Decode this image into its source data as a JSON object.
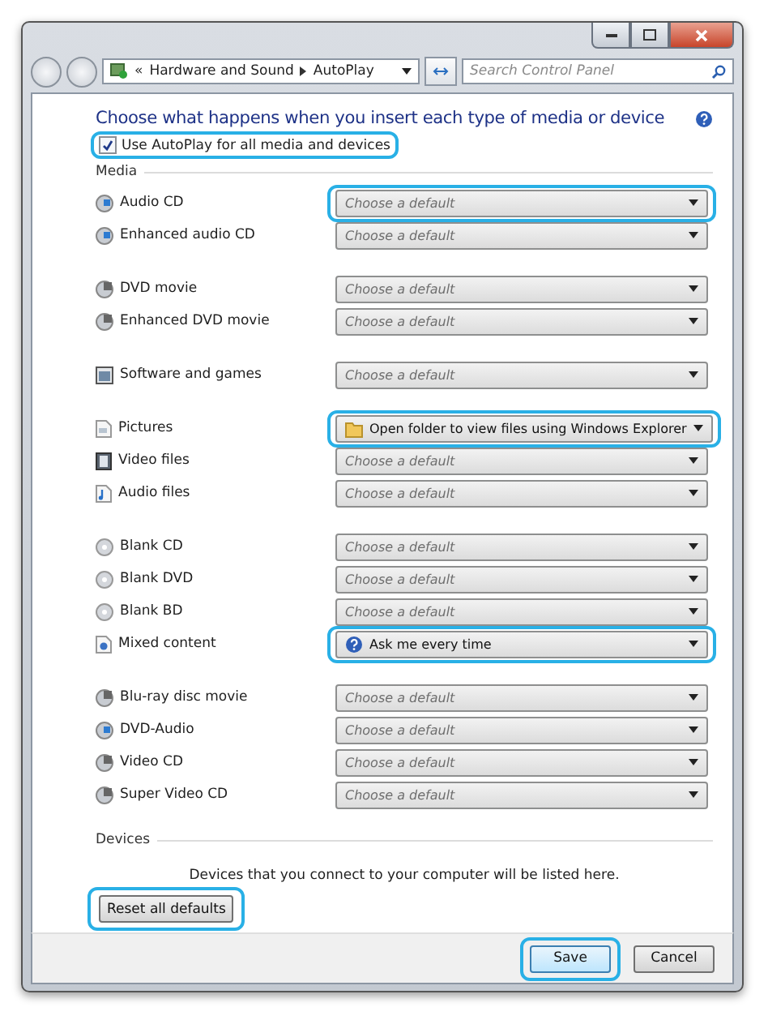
{
  "address_bar": {
    "breadcrumb": [
      "«",
      "Hardware and Sound",
      "AutoPlay"
    ]
  },
  "search": {
    "placeholder": "Search Control Panel"
  },
  "heading": "Choose what happens when you insert each type of media or device",
  "autoplay_checkbox": {
    "label": "Use AutoPlay for all media and devices",
    "checked": true,
    "highlighted": true
  },
  "media_section": {
    "title": "Media",
    "groups": [
      [
        {
          "name": "Audio CD",
          "kind": "cd",
          "choice": {
            "text": "Choose a default",
            "kind": "placeholder"
          },
          "highlighted": true
        },
        {
          "name": "Enhanced audio CD",
          "kind": "cd",
          "choice": {
            "text": "Choose a default",
            "kind": "placeholder"
          },
          "highlighted": false
        }
      ],
      [
        {
          "name": "DVD movie",
          "kind": "dvd",
          "choice": {
            "text": "Choose a default",
            "kind": "placeholder"
          },
          "highlighted": false
        },
        {
          "name": "Enhanced DVD movie",
          "kind": "dvd",
          "choice": {
            "text": "Choose a default",
            "kind": "placeholder"
          },
          "highlighted": false
        }
      ],
      [
        {
          "name": "Software and games",
          "kind": "software",
          "choice": {
            "text": "Choose a default",
            "kind": "placeholder"
          },
          "highlighted": false
        }
      ],
      [
        {
          "name": "Pictures",
          "kind": "picture",
          "choice": {
            "text": "Open folder to view files using Windows Explorer",
            "kind": "folder"
          },
          "highlighted": true
        },
        {
          "name": "Video files",
          "kind": "video",
          "choice": {
            "text": "Choose a default",
            "kind": "placeholder"
          },
          "highlighted": false
        },
        {
          "name": "Audio files",
          "kind": "audio",
          "choice": {
            "text": "Choose a default",
            "kind": "placeholder"
          },
          "highlighted": false
        }
      ],
      [
        {
          "name": "Blank CD",
          "kind": "blank",
          "choice": {
            "text": "Choose a default",
            "kind": "placeholder"
          },
          "highlighted": false
        },
        {
          "name": "Blank DVD",
          "kind": "blank",
          "choice": {
            "text": "Choose a default",
            "kind": "placeholder"
          },
          "highlighted": false
        },
        {
          "name": "Blank BD",
          "kind": "blank",
          "choice": {
            "text": "Choose a default",
            "kind": "placeholder"
          },
          "highlighted": false
        },
        {
          "name": "Mixed content",
          "kind": "mixed",
          "choice": {
            "text": "Ask me every time",
            "kind": "help"
          },
          "highlighted": true
        }
      ],
      [
        {
          "name": "Blu-ray disc movie",
          "kind": "dvd",
          "choice": {
            "text": "Choose a default",
            "kind": "placeholder"
          },
          "highlighted": false
        },
        {
          "name": "DVD-Audio",
          "kind": "cd",
          "choice": {
            "text": "Choose a default",
            "kind": "placeholder"
          },
          "highlighted": false
        },
        {
          "name": "Video CD",
          "kind": "dvd",
          "choice": {
            "text": "Choose a default",
            "kind": "placeholder"
          },
          "highlighted": false
        },
        {
          "name": "Super Video CD",
          "kind": "dvd",
          "choice": {
            "text": "Choose a default",
            "kind": "placeholder"
          },
          "highlighted": false
        }
      ]
    ]
  },
  "devices_section": {
    "title": "Devices",
    "message": "Devices that you connect to your computer will be listed here."
  },
  "reset_button": {
    "label": "Reset all defaults",
    "highlighted": true
  },
  "footer_buttons": [
    {
      "label": "Save",
      "highlighted": true,
      "default": true
    },
    {
      "label": "Cancel",
      "highlighted": false,
      "default": false
    }
  ]
}
